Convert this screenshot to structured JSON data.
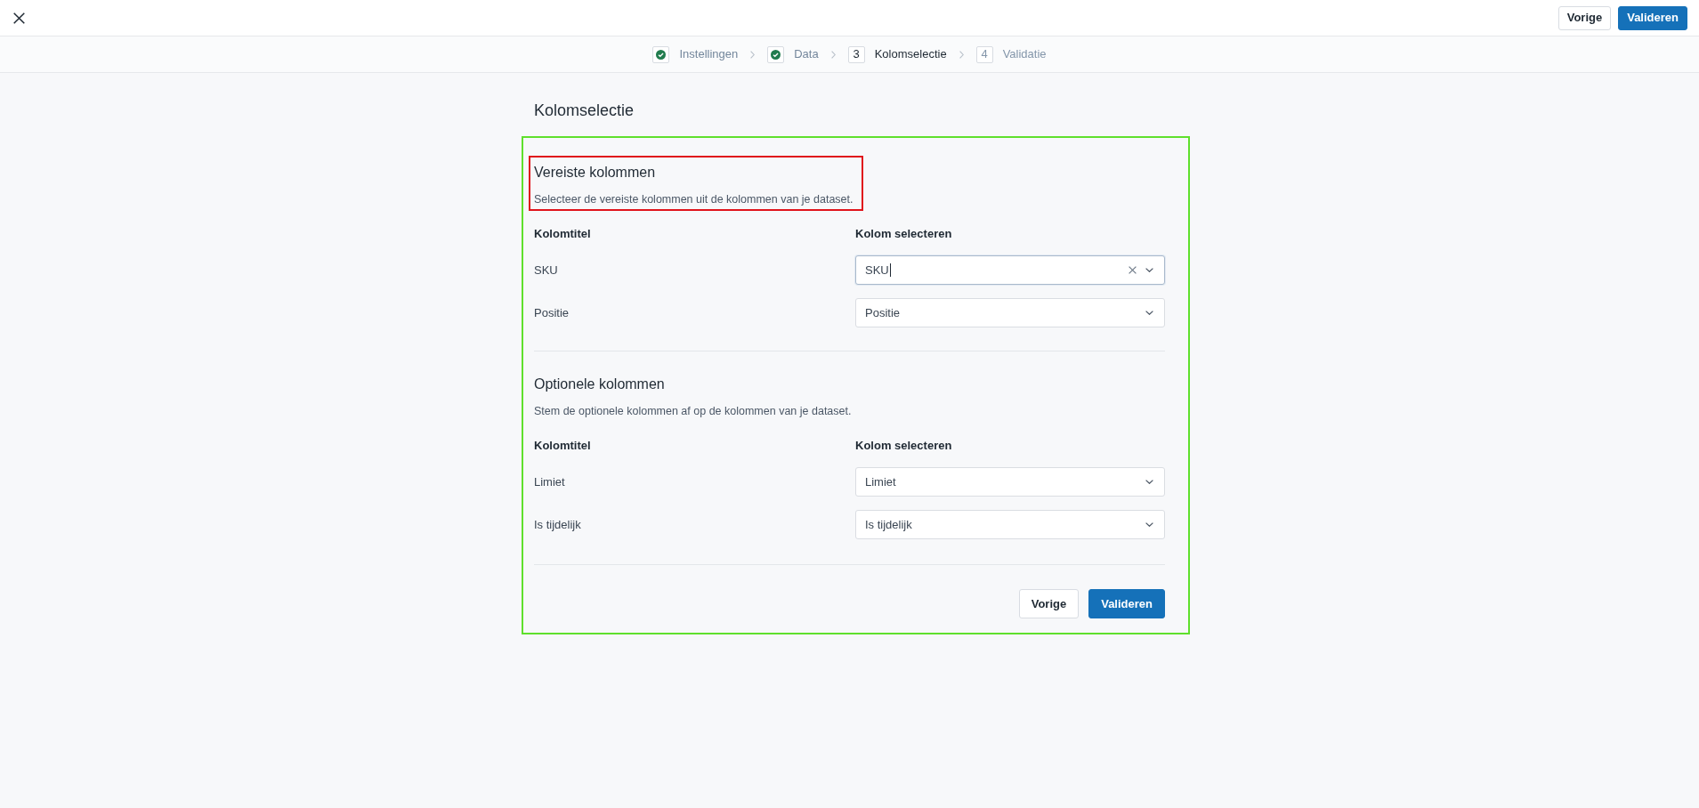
{
  "header": {
    "buttons": [
      {
        "label": "Vorige",
        "kind": "secondary"
      },
      {
        "label": "Valideren",
        "kind": "primary"
      }
    ]
  },
  "steps": [
    {
      "label": "Instellingen",
      "completed": true,
      "selected": false
    },
    {
      "label": "Data",
      "completed": true,
      "selected": false
    },
    {
      "number": "3",
      "label": "Kolomselectie",
      "completed": false,
      "selected": true
    },
    {
      "number": "4",
      "label": "Validatie",
      "completed": false,
      "selected": false
    }
  ],
  "page_title": "Kolomselectie",
  "card": {
    "outlined": true,
    "sections": [
      {
        "title": "Vereiste kolommen",
        "description": "Selecteer de vereiste kolommen uit de kolommen van je dataset.",
        "highlighted": true,
        "columns": [
          "Kolomtitel",
          "Kolom selecteren"
        ],
        "rows": [
          {
            "label": "SKU",
            "value": "SKU",
            "focused": true
          },
          {
            "label": "Positie",
            "value": "Positie",
            "focused": false
          }
        ]
      },
      {
        "title": "Optionele kolommen",
        "description": "Stem de optionele kolommen af op de kolommen van je dataset.",
        "highlighted": false,
        "columns": [
          "Kolomtitel",
          "Kolom selecteren"
        ],
        "rows": [
          {
            "label": "Limiet",
            "value": "Limiet",
            "focused": false
          },
          {
            "label": "Is tijdelijk",
            "value": "Is tijdelijk",
            "focused": false
          }
        ]
      }
    ],
    "buttons": [
      {
        "label": "Vorige",
        "kind": "secondary"
      },
      {
        "label": "Valideren",
        "kind": "primary"
      }
    ]
  }
}
